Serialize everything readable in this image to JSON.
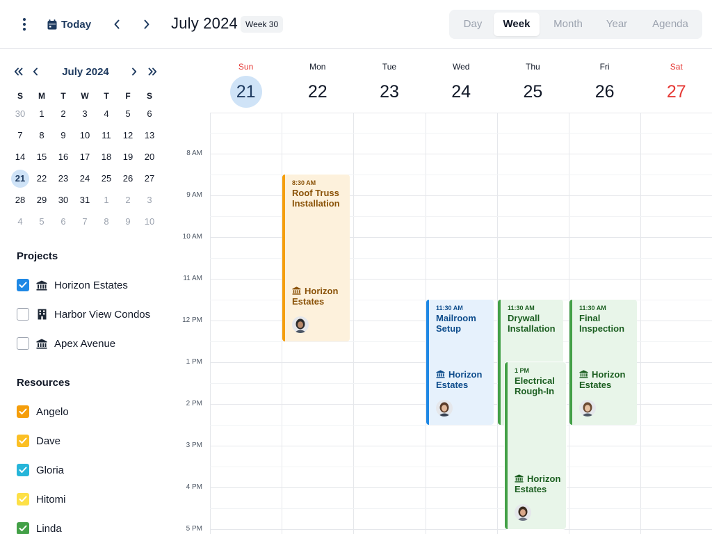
{
  "header": {
    "menu_icon": "more-vertical-icon",
    "today_label": "Today",
    "today_icon": "calendar-icon",
    "prev_icon": "chevron-left-icon",
    "next_icon": "chevron-right-icon",
    "title": "July 2024",
    "week_badge": "Week 30",
    "views": [
      "Day",
      "Week",
      "Month",
      "Year",
      "Agenda"
    ],
    "active_view": "Week"
  },
  "mini_calendar": {
    "title": "July 2024",
    "icons": [
      "double-chevron-left-icon",
      "chevron-left-icon",
      "chevron-right-icon",
      "double-chevron-right-icon"
    ],
    "weekday_labels": [
      "S",
      "M",
      "T",
      "W",
      "T",
      "F",
      "S"
    ],
    "weeks": [
      [
        "30",
        "1",
        "2",
        "3",
        "4",
        "5",
        "6"
      ],
      [
        "7",
        "8",
        "9",
        "10",
        "11",
        "12",
        "13"
      ],
      [
        "14",
        "15",
        "16",
        "17",
        "18",
        "19",
        "20"
      ],
      [
        "21",
        "22",
        "23",
        "24",
        "25",
        "26",
        "27"
      ],
      [
        "28",
        "29",
        "30",
        "31",
        "1",
        "2",
        "3"
      ],
      [
        "4",
        "5",
        "6",
        "7",
        "8",
        "9",
        "10"
      ]
    ],
    "selected": "21"
  },
  "projects": {
    "title": "Projects",
    "items": [
      {
        "label": "Horizon Estates",
        "checked": true,
        "icon": "bank-building-icon"
      },
      {
        "label": "Harbor View Condos",
        "checked": false,
        "icon": "apartment-building-icon"
      },
      {
        "label": "Apex Avenue",
        "checked": false,
        "icon": "bank-building-icon"
      }
    ]
  },
  "resources": {
    "title": "Resources",
    "items": [
      {
        "label": "Angelo",
        "checked": true,
        "color": "#f59e0b"
      },
      {
        "label": "Dave",
        "checked": true,
        "color": "#fbbf24"
      },
      {
        "label": "Gloria",
        "checked": true,
        "color": "#26b5d9"
      },
      {
        "label": "Hitomi",
        "checked": true,
        "color": "#fde047"
      },
      {
        "label": "Linda",
        "checked": true,
        "color": "#43a047"
      }
    ]
  },
  "week": {
    "days": [
      {
        "dow": "Sun",
        "num": "21",
        "today": true
      },
      {
        "dow": "Mon",
        "num": "22"
      },
      {
        "dow": "Tue",
        "num": "23"
      },
      {
        "dow": "Wed",
        "num": "24"
      },
      {
        "dow": "Thu",
        "num": "25"
      },
      {
        "dow": "Fri",
        "num": "26"
      },
      {
        "dow": "Sat",
        "num": "27",
        "weekend": true
      }
    ],
    "time_labels": [
      "8 AM",
      "9 AM",
      "10 AM",
      "11 AM",
      "12 PM",
      "1 PM",
      "2 PM",
      "3 PM",
      "4 PM",
      "5 PM"
    ],
    "colors": {
      "weekend": "#e53935",
      "today_bg": "#cfe3f7",
      "today_text": "#1e3a5f"
    }
  },
  "events": [
    {
      "time": "8:30 AM",
      "title": "Roof Truss Installation",
      "project": "Horizon Estates",
      "day": 1,
      "start": 8.5,
      "end": 12.5,
      "color": "orange"
    },
    {
      "time": "11:30 AM",
      "title": "Mailroom Setup",
      "project": "Horizon Estates",
      "day": 3,
      "start": 11.5,
      "end": 14.5,
      "color": "blue"
    },
    {
      "time": "11:30 AM",
      "title": "Drywall Installation",
      "project": "",
      "day": 4,
      "start": 11.5,
      "end": 14.5,
      "color": "green"
    },
    {
      "time": "1 PM",
      "title": "Electrical Rough-In",
      "project": "Horizon Estates",
      "day": 4,
      "start": 13,
      "end": 17,
      "color": "green"
    },
    {
      "time": "11:30 AM",
      "title": "Final Inspection",
      "project": "Horizon Estates",
      "day": 5,
      "start": 11.5,
      "end": 14.5,
      "color": "green"
    }
  ]
}
